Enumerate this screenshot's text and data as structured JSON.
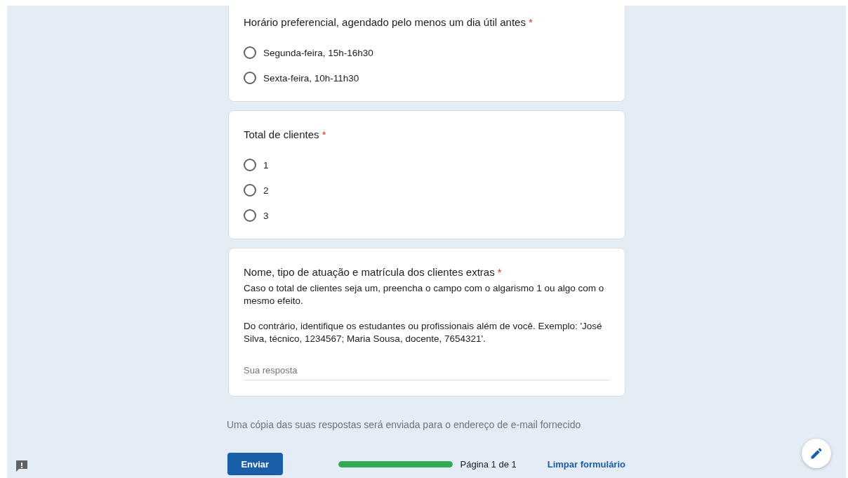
{
  "questions": [
    {
      "title": "Horário preferencial, agendado pelo menos um dia útil antes",
      "required": true,
      "kind": "radio",
      "options": [
        {
          "label": "Segunda-feira, 15h-16h30",
          "selected": false
        },
        {
          "label": "Sexta-feira, 10h-11h30",
          "selected": false
        }
      ]
    },
    {
      "title": "Total de clientes",
      "required": true,
      "kind": "radio",
      "options": [
        {
          "label": "1",
          "selected": false
        },
        {
          "label": "2",
          "selected": false
        },
        {
          "label": "3",
          "selected": false
        }
      ]
    },
    {
      "title": "Nome, tipo de atuação e matrícula dos clientes extras",
      "required": true,
      "kind": "text",
      "description": [
        "Caso o total de clientes seja um, preencha o campo com o algarismo 1 ou algo com o mesmo efeito.",
        "Do contrário, identifique os estudantes ou profissionais além de você. Exemplo: 'José Silva, técnico, 1234567; Maria Sousa, docente, 7654321'."
      ],
      "placeholder": "Sua resposta"
    }
  ],
  "required_mark": "*",
  "copy_notice": "Uma cópia das suas respostas será enviada para o endereço de e-mail fornecido",
  "submit_button": "Enviar",
  "progress": {
    "level": 1,
    "label": "Página 1 de 1"
  },
  "clear_link": "Limpar formulário"
}
